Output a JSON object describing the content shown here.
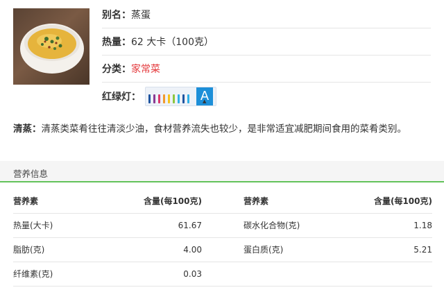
{
  "food": {
    "image_alt": "蒸蛋",
    "rows": {
      "alias": {
        "label": "别名：",
        "value": "蒸蛋"
      },
      "calorie": {
        "label": "热量：",
        "value": "62 大卡（100克）"
      },
      "category": {
        "label": "分类：",
        "value": "家常菜"
      },
      "lights": {
        "label": "红绿灯：",
        "grade": "A"
      }
    },
    "light_bar_colors": [
      "#1f55a0",
      "#8a3a93",
      "#d9376e",
      "#f19a2c",
      "#f5c21b",
      "#8cc63f",
      "#2fb0e6",
      "#1f55a0",
      "#2fb0e6"
    ],
    "category_color": "#e4393c",
    "grade_color": "#1d8fd8"
  },
  "description": {
    "label": "清蒸：",
    "text": "清蒸类菜肴往往清淡少油，食材营养流失也较少，是非常适宜减肥期间食用的菜肴类别。"
  },
  "nutrition": {
    "section_title": "营养信息",
    "accent_color": "#62c25a",
    "headers": [
      "营养素",
      "含量(每100克)",
      "营养素",
      "含量(每100克)"
    ],
    "rows": [
      [
        "热量(大卡)",
        "61.67",
        "碳水化合物(克)",
        "1.18"
      ],
      [
        "脂肪(克)",
        "4.00",
        "蛋白质(克)",
        "5.21"
      ],
      [
        "纤维素(克)",
        "0.03",
        "",
        ""
      ]
    ]
  }
}
